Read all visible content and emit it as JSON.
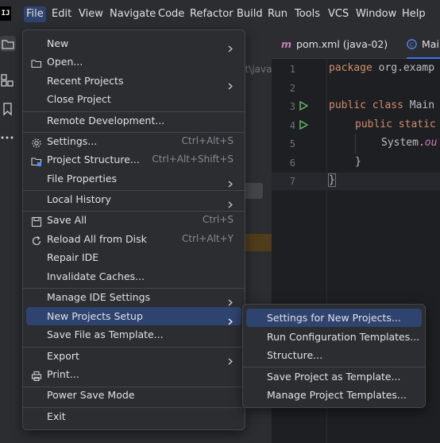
{
  "app": {
    "logo_text": "IJ"
  },
  "menubar": {
    "items": [
      "File",
      "Edit",
      "View",
      "Navigate",
      "Code",
      "Refactor",
      "Build",
      "Run",
      "Tools",
      "VCS",
      "Window",
      "Help"
    ],
    "active": "File"
  },
  "project_panel": {
    "path_fragment": "ct\\java"
  },
  "editor": {
    "tabs": [
      {
        "label": "pom.xml (java-02)",
        "icon": "maven-icon"
      },
      {
        "label": "Main",
        "icon": "class-icon"
      }
    ],
    "line_numbers": [
      "1",
      "2",
      "3",
      "4",
      "5",
      "6",
      "7"
    ],
    "code": {
      "line1_kw": "package",
      "line1_rest": " org.examp",
      "line3_kw": "public class",
      "line3_rest": " Main",
      "line4_kw": "public static",
      "line5_obj": "System.",
      "line5_field": "ou",
      "line6": "}",
      "line7": "}"
    }
  },
  "file_menu": {
    "items": [
      {
        "label": "New",
        "shortcut": "",
        "submenu": true,
        "icon": ""
      },
      {
        "label": "Open...",
        "shortcut": "",
        "submenu": false,
        "icon": "folder-icon"
      },
      {
        "label": "Recent Projects",
        "shortcut": "",
        "submenu": true,
        "icon": ""
      },
      {
        "label": "Close Project",
        "shortcut": "",
        "submenu": false,
        "icon": ""
      },
      {
        "label": "Remote Development...",
        "shortcut": "",
        "submenu": false,
        "icon": ""
      },
      {
        "label": "Settings...",
        "shortcut": "Ctrl+Alt+S",
        "submenu": false,
        "icon": "gear-icon"
      },
      {
        "label": "Project Structure...",
        "shortcut": "Ctrl+Alt+Shift+S",
        "submenu": false,
        "icon": "project-structure-icon"
      },
      {
        "label": "File Properties",
        "shortcut": "",
        "submenu": true,
        "icon": ""
      },
      {
        "label": "Local History",
        "shortcut": "",
        "submenu": true,
        "icon": ""
      },
      {
        "label": "Save All",
        "shortcut": "Ctrl+S",
        "submenu": false,
        "icon": "save-icon"
      },
      {
        "label": "Reload All from Disk",
        "shortcut": "Ctrl+Alt+Y",
        "submenu": false,
        "icon": "reload-icon"
      },
      {
        "label": "Repair IDE",
        "shortcut": "",
        "submenu": false,
        "icon": ""
      },
      {
        "label": "Invalidate Caches...",
        "shortcut": "",
        "submenu": false,
        "icon": ""
      },
      {
        "label": "Manage IDE Settings",
        "shortcut": "",
        "submenu": true,
        "icon": ""
      },
      {
        "label": "New Projects Setup",
        "shortcut": "",
        "submenu": true,
        "icon": ""
      },
      {
        "label": "Save File as Template...",
        "shortcut": "",
        "submenu": false,
        "icon": ""
      },
      {
        "label": "Export",
        "shortcut": "",
        "submenu": true,
        "icon": ""
      },
      {
        "label": "Print...",
        "shortcut": "",
        "submenu": false,
        "icon": "print-icon"
      },
      {
        "label": "Power Save Mode",
        "shortcut": "",
        "submenu": false,
        "icon": ""
      },
      {
        "label": "Exit",
        "shortcut": "",
        "submenu": false,
        "icon": ""
      }
    ],
    "selected": "New Projects Setup"
  },
  "sub_menu": {
    "items": [
      "Settings for New Projects...",
      "Run Configuration Templates...",
      "Structure...",
      "Save Project as Template...",
      "Manage Project Templates..."
    ],
    "selected": "Settings for New Projects..."
  },
  "colors": {
    "accent": "#2e436e",
    "panel": "#2b2d30",
    "editor_bg": "#1e1f22",
    "keyword": "#cf8e6d",
    "run_green": "#5fb865"
  }
}
